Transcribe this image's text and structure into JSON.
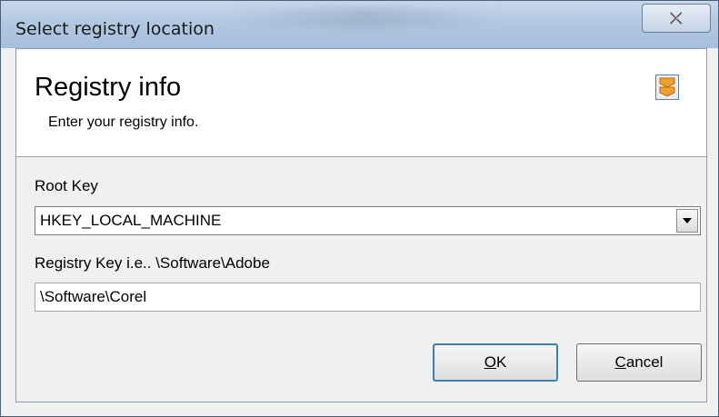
{
  "window": {
    "title": "Select registry location",
    "close_icon": "close-x-icon"
  },
  "header": {
    "title": "Registry info",
    "subtitle": "Enter your registry info.",
    "icon": "registry-arrows-icon",
    "icon_color": "#f0a030"
  },
  "root_key": {
    "label": "Root Key",
    "selected": "HKEY_LOCAL_MACHINE"
  },
  "registry_key": {
    "label": "Registry Key i.e..  \\Software\\Adobe",
    "value": "\\Software\\Corel"
  },
  "buttons": {
    "ok": {
      "accel": "O",
      "rest": "K"
    },
    "cancel": {
      "accel": "C",
      "rest": "ancel"
    }
  }
}
